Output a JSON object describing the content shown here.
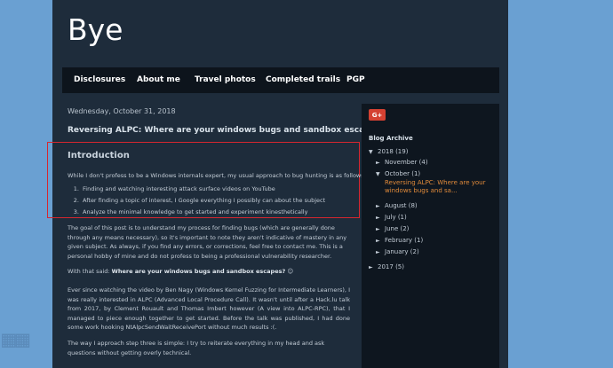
{
  "blog": {
    "title": "Bye"
  },
  "nav": {
    "items": [
      "Disclosures",
      "About me",
      "Travel photos",
      "Completed trails",
      "PGP"
    ]
  },
  "post": {
    "date": "Wednesday, October 31, 2018",
    "title": "Reversing ALPC: Where are your windows bugs and sandbox escapes?",
    "intro_heading": "Introduction",
    "intro_text": "While I don't profess to be a Windows internals expert, my usual approach to bug hunting is as follows:",
    "steps": [
      "Finding and watching interesting attack surface videos on YouTube",
      "After finding a topic of interest, I Google everything I possibly can about the subject",
      "Analyze the minimal knowledge to get started and experiment kinesthetically"
    ],
    "para2": "The goal of this post is to understand my process for finding bugs (which are generally done through any means necessary), so it's important to note they aren't indicative of mastery in any given subject. As always, if you find any errors, or corrections, feel free to contact me. This is a personal hobby of mine and do not profess to being a professional vulnerability researcher.",
    "para3_prefix": "With that said: ",
    "para3_bold": "Where are your windows bugs and sandbox escapes?",
    "para3_suffix": " ☺",
    "para4": "Ever since watching the video by Ben Nagy (Windows Kernel Fuzzing for Intermediate Learners), I was really interested in ALPC (Advanced Local Procedure Call). It wasn't until after a Hack.lu talk from 2017, by Clement Rouault and Thomas Imbert however (A view into ALPC-RPC), that I managed to piece enough together to get started. Before the talk was published, I had done some work hooking NtAlpcSendWaitReceivePort without much results :(.",
    "para5": "The way I approach step three is simple: I try to reiterate everything in my head and ask questions without getting overly technical."
  },
  "sidebar": {
    "gplus_label": "G+",
    "archive_title": "Blog Archive",
    "archive": [
      {
        "label": "2018",
        "count": "(19)",
        "state": "expanded"
      },
      {
        "label": "November",
        "count": "(4)",
        "state": "collapsed"
      },
      {
        "label": "October",
        "count": "(1)",
        "state": "expanded"
      },
      {
        "label": "August",
        "count": "(8)",
        "state": "collapsed"
      },
      {
        "label": "July",
        "count": "(1)",
        "state": "collapsed"
      },
      {
        "label": "June",
        "count": "(2)",
        "state": "collapsed"
      },
      {
        "label": "February",
        "count": "(1)",
        "state": "collapsed"
      },
      {
        "label": "January",
        "count": "(2)",
        "state": "collapsed"
      },
      {
        "label": "2017",
        "count": "(5)",
        "state": "collapsed"
      }
    ],
    "archive_post": "Reversing ALPC: Where are your windows bugs and sa..."
  },
  "icons": {
    "expanded": "triangle-down-icon",
    "collapsed": "triangle-right-icon"
  },
  "colors": {
    "background": "#6aa0d2",
    "page": "#1e2c3b",
    "nav": "#0d141c",
    "highlight": "#d7262f",
    "link_orange": "#e08a3a",
    "gplus": "#d44132"
  }
}
